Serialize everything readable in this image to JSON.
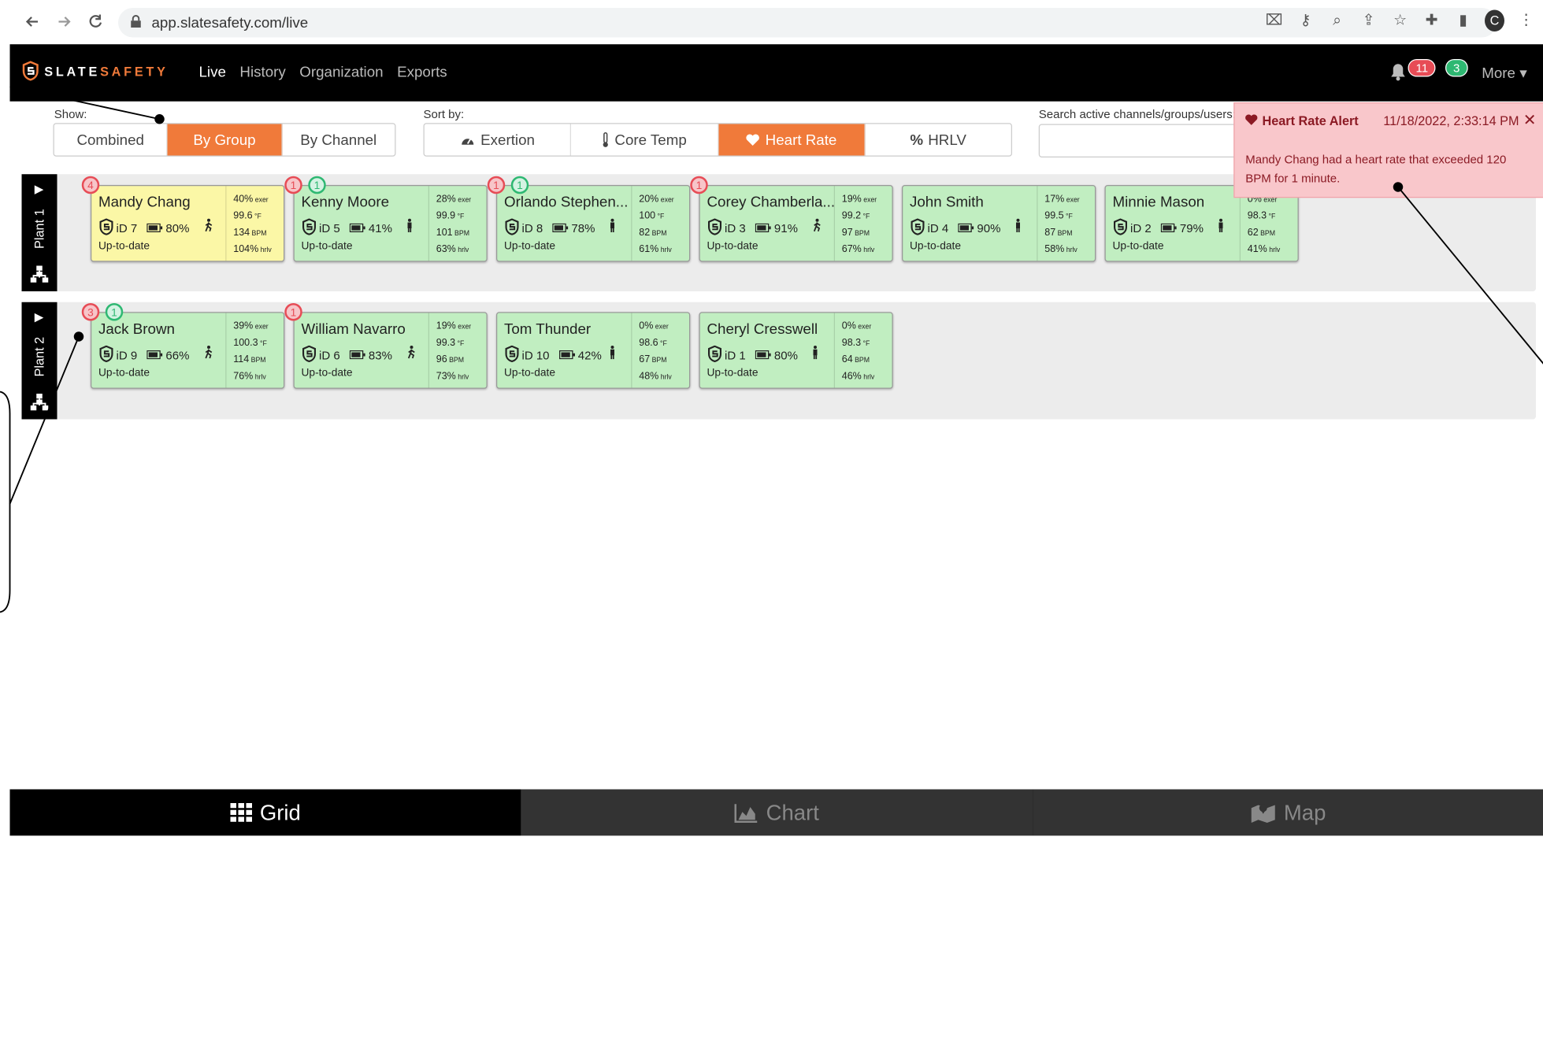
{
  "browser": {
    "url": "app.slatesafety.com/live",
    "profile_initial": "C"
  },
  "header": {
    "logo_part1": "SLATE",
    "logo_part2": "SAFETY",
    "nav": [
      "Live",
      "History",
      "Organization",
      "Exports"
    ],
    "alerts_red": "11",
    "alerts_green": "3",
    "more": "More"
  },
  "controls": {
    "show_label": "Show:",
    "show_options": [
      "Combined",
      "By Group",
      "By Channel"
    ],
    "sort_label": "Sort by:",
    "sort_options": [
      "Exertion",
      "Core Temp",
      "Heart Rate",
      "HRLV"
    ],
    "search_label": "Search active channels/groups/users:"
  },
  "alert": {
    "title": "Heart Rate Alert",
    "time": "11/18/2022, 2:33:14 PM",
    "message": "Mandy Chang had a heart rate that exceeded 120 BPM for 1 minute."
  },
  "plants": [
    {
      "name": "Plant 1",
      "cards": [
        {
          "name": "Mandy Chang",
          "id": "iD 7",
          "battery": "80%",
          "status": "Up-to-date",
          "exer": "40%",
          "temp": "99.6",
          "bpm": "134",
          "hrlv": "104%",
          "red": "4",
          "green": "",
          "alert": true
        },
        {
          "name": "Kenny Moore",
          "id": "iD 5",
          "battery": "41%",
          "status": "Up-to-date",
          "exer": "28%",
          "temp": "99.9",
          "bpm": "101",
          "hrlv": "63%",
          "red": "1",
          "green": "1"
        },
        {
          "name": "Orlando Stephen...",
          "id": "iD 8",
          "battery": "78%",
          "status": "Up-to-date",
          "exer": "20%",
          "temp": "100",
          "bpm": "82",
          "hrlv": "61%",
          "red": "1",
          "green": "1"
        },
        {
          "name": "Corey Chamberla...",
          "id": "iD 3",
          "battery": "91%",
          "status": "Up-to-date",
          "exer": "19%",
          "temp": "99.2",
          "bpm": "97",
          "hrlv": "67%",
          "red": "1",
          "green": ""
        },
        {
          "name": "John Smith",
          "id": "iD 4",
          "battery": "90%",
          "status": "Up-to-date",
          "exer": "17%",
          "temp": "99.5",
          "bpm": "87",
          "hrlv": "58%",
          "red": "",
          "green": ""
        },
        {
          "name": "Minnie Mason",
          "id": "iD 2",
          "battery": "79%",
          "status": "Up-to-date",
          "exer": "0%",
          "temp": "98.3",
          "bpm": "62",
          "hrlv": "41%",
          "red": "",
          "green": ""
        }
      ]
    },
    {
      "name": "Plant 2",
      "cards": [
        {
          "name": "Jack Brown",
          "id": "iD 9",
          "battery": "66%",
          "status": "Up-to-date",
          "exer": "39%",
          "temp": "100.3",
          "bpm": "114",
          "hrlv": "76%",
          "red": "3",
          "green": "1"
        },
        {
          "name": "William Navarro",
          "id": "iD 6",
          "battery": "83%",
          "status": "Up-to-date",
          "exer": "19%",
          "temp": "99.3",
          "bpm": "96",
          "hrlv": "73%",
          "red": "1",
          "green": ""
        },
        {
          "name": "Tom Thunder",
          "id": "iD 10",
          "battery": "42%",
          "status": "Up-to-date",
          "exer": "0%",
          "temp": "98.6",
          "bpm": "67",
          "hrlv": "48%",
          "red": "",
          "green": ""
        },
        {
          "name": "Cheryl Cresswell",
          "id": "iD 1",
          "battery": "80%",
          "status": "Up-to-date",
          "exer": "0%",
          "temp": "98.3",
          "bpm": "64",
          "hrlv": "46%",
          "red": "",
          "green": ""
        }
      ]
    }
  ],
  "units": {
    "exer": "exer",
    "temp": "°F",
    "bpm": "BPM",
    "hrlv": "hrlv"
  },
  "bottom_tabs": [
    "Grid",
    "Chart",
    "Map"
  ],
  "colors": {
    "accent": "#f07a3a",
    "card_green": "#c1eec1",
    "card_yellow": "#fbf7a6",
    "alert_bg": "#f9c7cb"
  }
}
